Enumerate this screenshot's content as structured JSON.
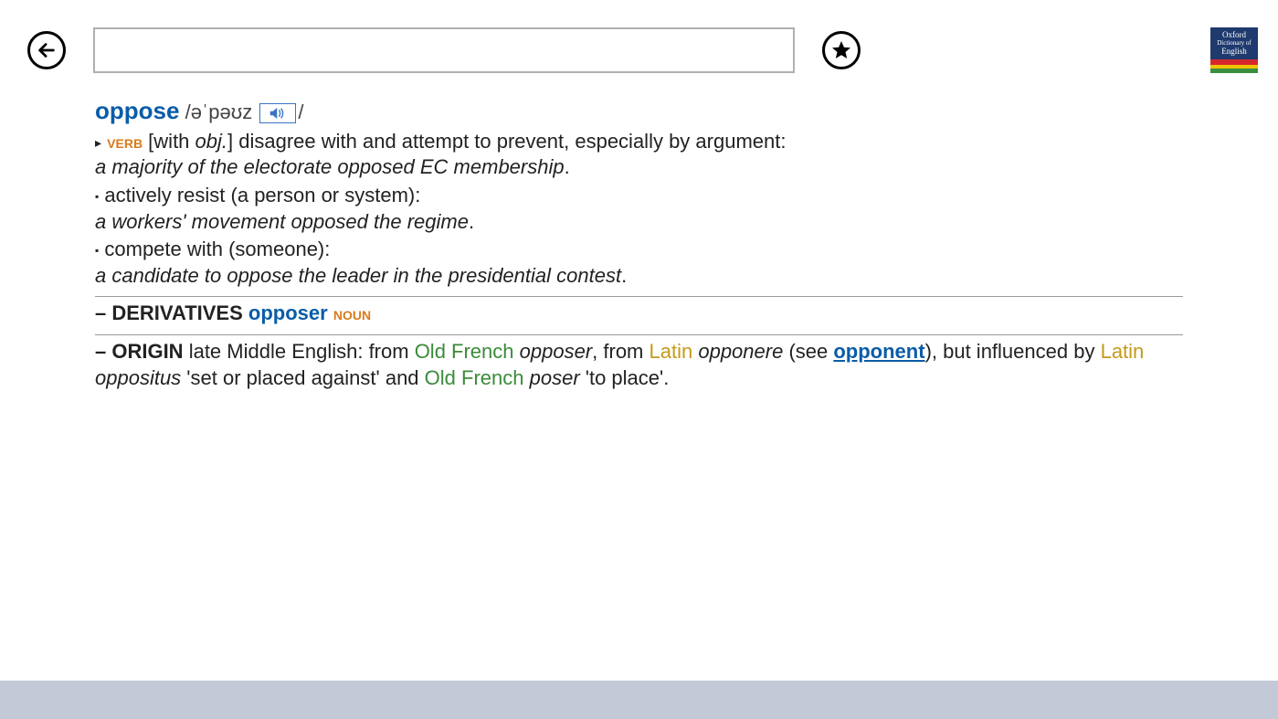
{
  "logo": {
    "line1": "Oxford",
    "line2": "Dictionary of",
    "line3": "English"
  },
  "search": {
    "value": ""
  },
  "entry": {
    "headword": "oppose",
    "pron_open": " /",
    "pron": "əˈpəʊz",
    "pron_close": "/",
    "senses": [
      {
        "marker": "▸",
        "pos": "verb",
        "gram_open": " [with ",
        "gram_italic": "obj.",
        "gram_close": "] ",
        "def": "disagree with and attempt to prevent, especially by argument:",
        "example": "a majority of the electorate opposed EC membership",
        "example_end": "."
      },
      {
        "marker": "▪",
        "def": " actively resist (a person or system):",
        "example": "a workers' movement opposed the regime",
        "example_end": "."
      },
      {
        "marker": "▪",
        "def": " compete with (someone):",
        "example": "a candidate to oppose the leader in the presidential contest",
        "example_end": "."
      }
    ],
    "derivatives": {
      "label": "– DERIVATIVES",
      "word": "opposer",
      "pos": "noun"
    },
    "origin": {
      "label": "– ORIGIN",
      "p1": " late Middle English: from ",
      "lang1": "Old French",
      "w1": "opposer",
      "p2": ", from ",
      "lang2": "Latin",
      "w2": "opponere",
      "p3": " (see ",
      "xref": "opponent",
      "p4": "), but influenced by ",
      "lang3": "Latin",
      "w3": "oppositus",
      "p5": " 'set or placed against' and ",
      "lang4": "Old French",
      "w4": "poser",
      "p6": " 'to place'."
    }
  }
}
